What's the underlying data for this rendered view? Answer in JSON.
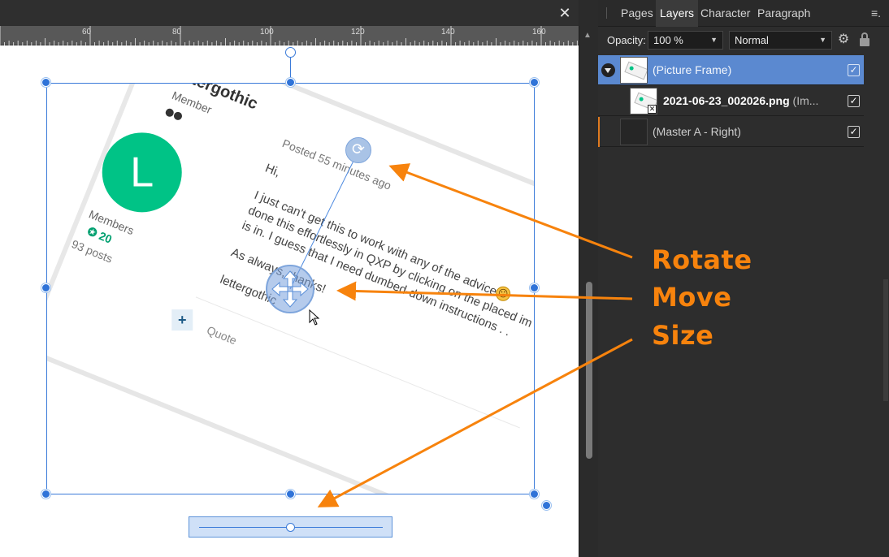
{
  "document": {
    "close_label": "✕",
    "ruler_labels": [
      "60",
      "80",
      "100",
      "120",
      "140",
      "160"
    ]
  },
  "post": {
    "username": "lettergothic",
    "role": "Member",
    "avatar_letter": "L",
    "member_group": "Members",
    "reputation": "✪ 20",
    "posts_count": "93 posts",
    "posted_time": "Posted 55 minutes ago",
    "greeting": "Hi,",
    "body_line_1": "I just can't get this to work with any of the advice.",
    "body_line_2": "done this effortlessly in QXP by clicking on the placed im",
    "body_line_3": "is in. I guess that I need dumbed-down instructions . .",
    "sign_line": "As always, thanks!",
    "signature": "lettergothic",
    "emoji": "☹",
    "quote_icon": "+",
    "quote_label": "Quote"
  },
  "gizmos": {
    "rotate_icon": "⟳"
  },
  "annotations": {
    "rotate": "Rotate",
    "move": "Move",
    "size": "Size",
    "color": "#f7830d"
  },
  "panel": {
    "tabs": [
      "Pages",
      "Layers",
      "Character",
      "Paragraph"
    ],
    "active_tab": "Layers",
    "menu_icon": "≡.",
    "opacity_label": "Opacity:",
    "opacity_value": "100 %",
    "blend_mode": "Normal",
    "gear_icon": "⚙",
    "layers": [
      {
        "name": "(Picture Frame)",
        "checked": "✓"
      },
      {
        "name": "2021-06-23_002026.png",
        "suffix": " (Im...",
        "checked": "✓"
      },
      {
        "name": "(Master A - Right)",
        "checked": "✓"
      }
    ],
    "selection_color": "#5b89d0"
  }
}
